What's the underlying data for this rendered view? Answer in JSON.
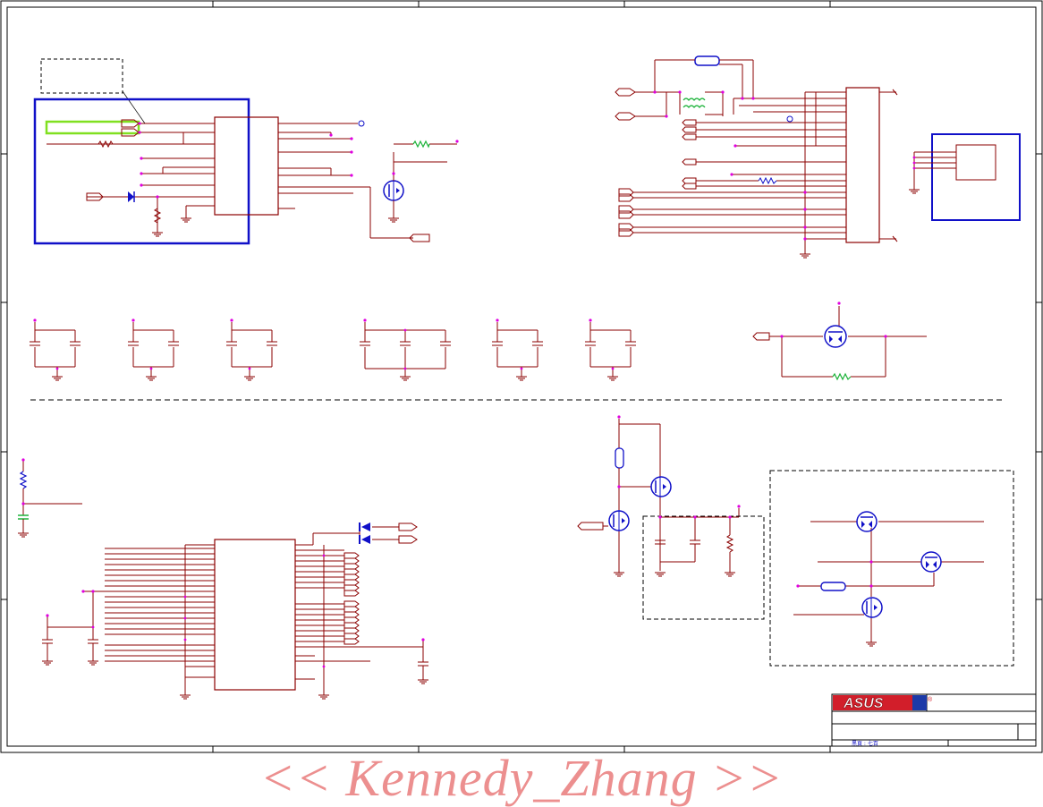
{
  "title_block": {
    "brand_logo": "ASUS",
    "registered_mark": "®",
    "footer_small_text": "黑頁 : 七百"
  },
  "watermark": {
    "text": "<< Kennedy_Zhang >>"
  },
  "colors": {
    "wire": "#8b0000",
    "outline": "#1010c8",
    "node": "#e000e0",
    "resistor_alt": "#1db33a",
    "highlight": "#80e020",
    "logo_red": "#d21e2a",
    "logo_blue": "#1d3aa8",
    "watermark": "#ec8f8f"
  }
}
